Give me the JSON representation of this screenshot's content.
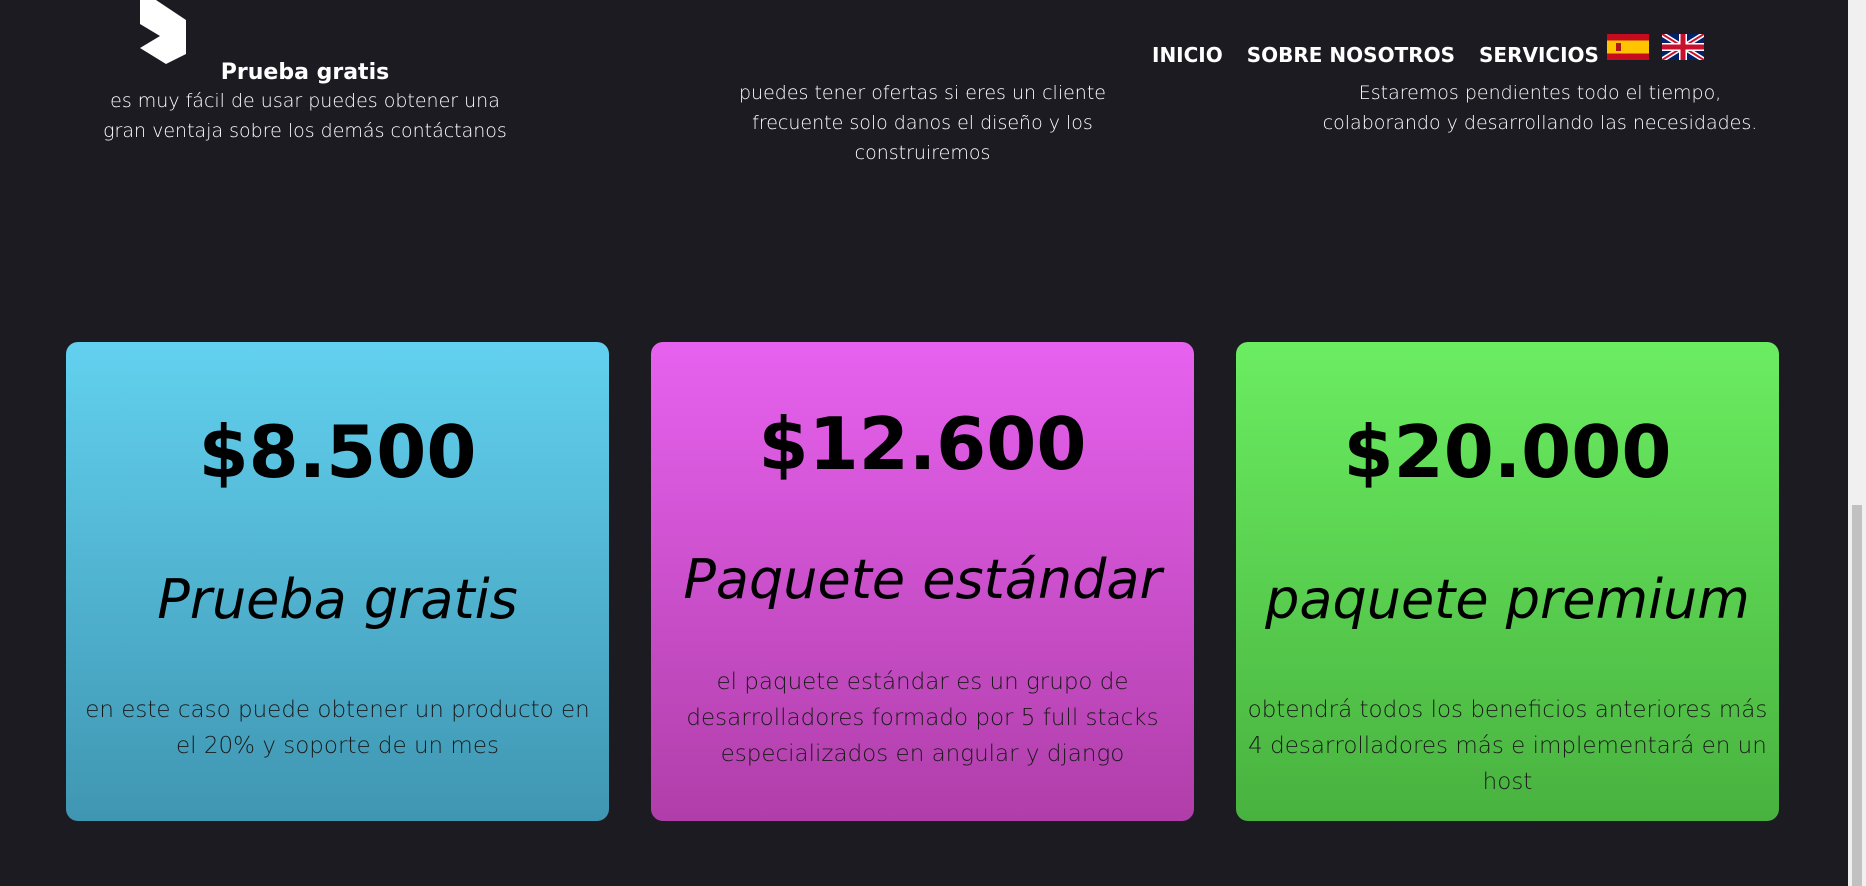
{
  "nav": {
    "items": [
      {
        "label": "INICIO"
      },
      {
        "label": "SOBRE NOSOTROS"
      },
      {
        "label": "SERVICIOS"
      }
    ]
  },
  "features": [
    {
      "title": "Prueba gratis",
      "text": "es muy fácil de usar puedes obtener una gran ventaja sobre los demás contáctanos"
    },
    {
      "title": "",
      "text": "puedes tener ofertas si eres un cliente frecuente solo danos el diseño y los construiremos"
    },
    {
      "title": "",
      "text": "Estaremos pendientes todo el tiempo, colaborando y desarrollando las necesidades."
    }
  ],
  "packages": [
    {
      "price": "$8.500",
      "name": "Prueba gratis",
      "description": "en este caso puede obtener un producto en el 20% y soporte de un mes"
    },
    {
      "price": "$12.600",
      "name": "Paquete estándar",
      "description": "el paquete estándar es un grupo de desarrolladores formado por 5 full stacks especializados en angular y django"
    },
    {
      "price": "$20.000",
      "name": "paquete premium",
      "description": "obtendrá todos los beneficios anteriores más 4 desarrolladores más e implementará en un host"
    }
  ],
  "icons": {
    "logo": "logo-icon",
    "flag_es": "spain-flag-icon",
    "flag_uk": "uk-flag-icon"
  },
  "colors": {
    "background": "#1c1b21",
    "card_1": "#62d1ef",
    "card_2": "#e762ef",
    "card_3": "#6bed61"
  }
}
